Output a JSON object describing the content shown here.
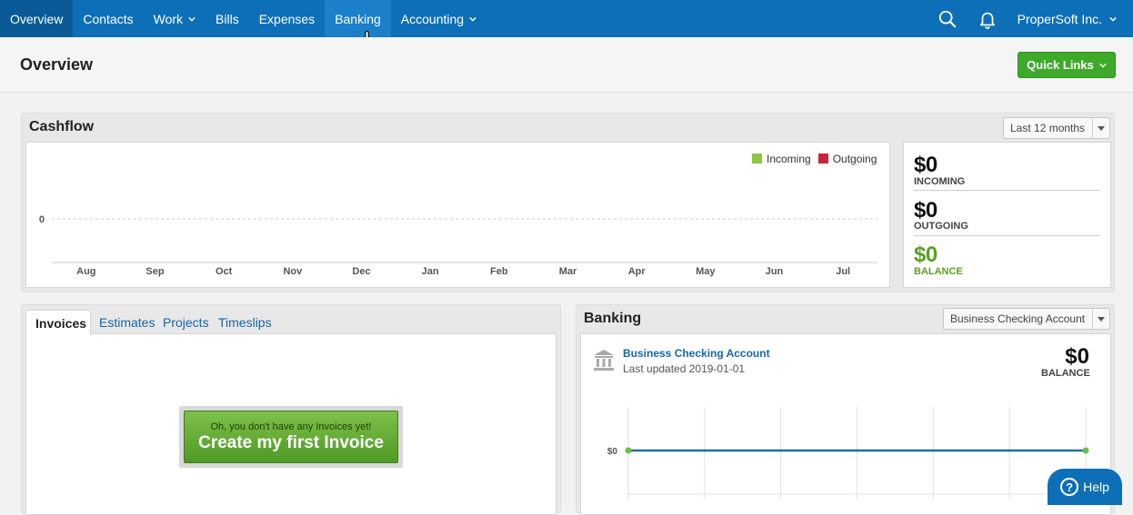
{
  "nav": {
    "items": [
      {
        "label": "Overview",
        "has_menu": false,
        "state": "active"
      },
      {
        "label": "Contacts",
        "has_menu": false
      },
      {
        "label": "Work",
        "has_menu": true
      },
      {
        "label": "Bills",
        "has_menu": false
      },
      {
        "label": "Expenses",
        "has_menu": false
      },
      {
        "label": "Banking",
        "has_menu": false,
        "state": "hover"
      },
      {
        "label": "Accounting",
        "has_menu": true
      }
    ],
    "company": "ProperSoft Inc.",
    "icons": [
      "search-icon",
      "bell-icon",
      "chevron-down-icon"
    ]
  },
  "header": {
    "title": "Overview",
    "quick_links": "Quick Links"
  },
  "cashflow": {
    "title": "Cashflow",
    "period": "Last 12 months",
    "incoming_label": "INCOMING",
    "incoming_amount": "$0",
    "outgoing_label": "OUTGOING",
    "outgoing_amount": "$0",
    "balance_label": "BALANCE",
    "balance_amount": "$0"
  },
  "invoices": {
    "tabs": [
      "Invoices",
      "Estimates",
      "Projects",
      "Timeslips"
    ],
    "active_tab": "Invoices",
    "empty_note": "Oh, you don't have any Invoices yet!",
    "cta": "Create my first Invoice"
  },
  "banking": {
    "title": "Banking",
    "account_select": "Business Checking Account",
    "account_name": "Business Checking Account",
    "last_updated": "Last updated 2019-01-01",
    "balance_amount": "$0",
    "balance_label": "BALANCE"
  },
  "help": {
    "label": "Help"
  },
  "colors": {
    "nav_bg": "#0d6fb8",
    "incoming": "#8cc63f",
    "outgoing": "#c8243a",
    "balance": "#5aa020",
    "bank_line": "#1f6fa8",
    "bank_point": "#6cc04a"
  },
  "chart_data": [
    {
      "type": "line",
      "categories": [
        "Aug",
        "Sep",
        "Oct",
        "Nov",
        "Dec",
        "Jan",
        "Feb",
        "Mar",
        "Apr",
        "May",
        "Jun",
        "Jul"
      ],
      "series": [
        {
          "name": "Incoming",
          "values": [
            0,
            0,
            0,
            0,
            0,
            0,
            0,
            0,
            0,
            0,
            0,
            0
          ]
        },
        {
          "name": "Outgoing",
          "values": [
            0,
            0,
            0,
            0,
            0,
            0,
            0,
            0,
            0,
            0,
            0,
            0
          ]
        }
      ],
      "y_ticks": [
        "0"
      ],
      "legend": "top-right",
      "grid": false
    },
    {
      "type": "line",
      "series": [
        {
          "values": [
            0,
            0
          ]
        }
      ],
      "y_ticks": [
        "$0"
      ],
      "grid": true
    }
  ]
}
